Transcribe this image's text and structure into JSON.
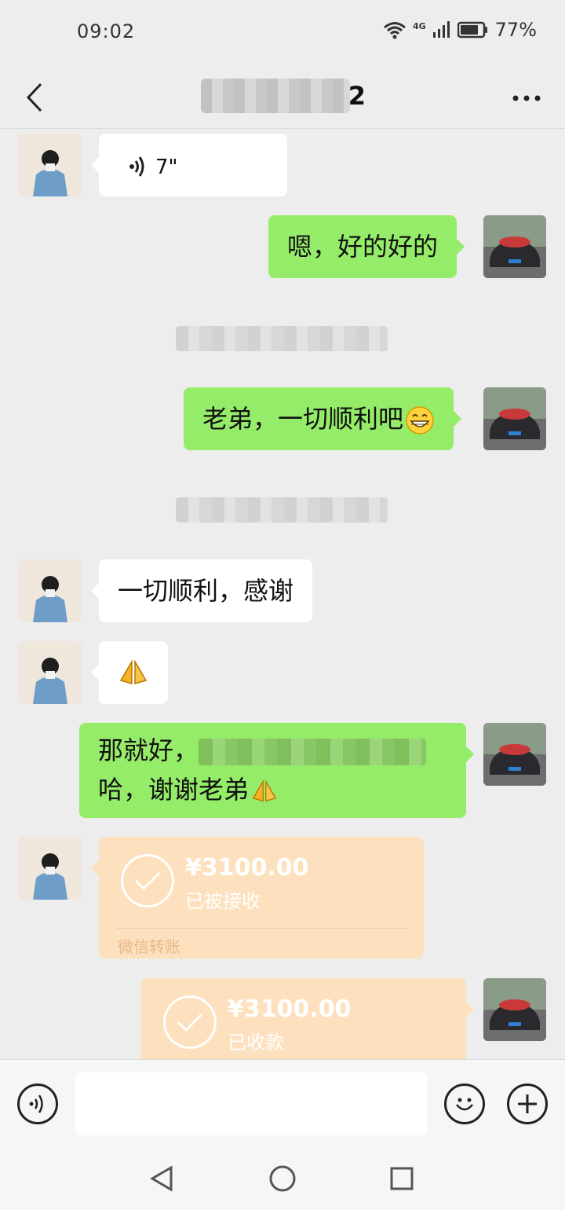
{
  "status_bar": {
    "time": "09:02",
    "network": "4G",
    "battery": "77%"
  },
  "header": {
    "title_suffix": "2"
  },
  "messages": {
    "voice": {
      "duration": "7\""
    },
    "reply_1": "嗯，好的好的",
    "msg_2": "老弟，一切顺利吧",
    "reply_2": "一切顺利，感谢",
    "thanks_emoji": "🙏",
    "msg_3_start": "那就好，",
    "msg_3_end": "哈，谢谢老弟"
  },
  "transfers": [
    {
      "amount": "¥3100.00",
      "status": "已被接收",
      "footer": "微信转账"
    },
    {
      "amount": "¥3100.00",
      "status": "已收款"
    }
  ],
  "input": {
    "placeholder": ""
  },
  "colors": {
    "bubble_green": "#95ec69",
    "transfer_bg": "#fde0bd",
    "background": "#ededed"
  },
  "icons": {
    "voice_toggle": "voice-wave-icon",
    "emoji": "smiley-icon",
    "more": "plus-circle-icon",
    "back": "chevron-left-icon",
    "menu": "ellipsis-icon"
  }
}
